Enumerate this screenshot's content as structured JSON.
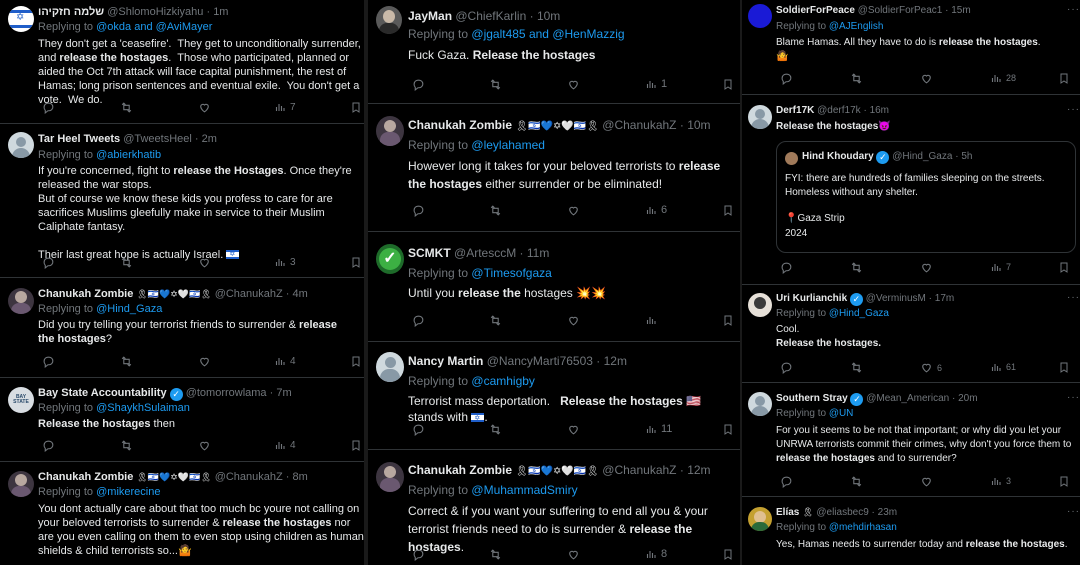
{
  "common": {
    "replying_to": "Replying to",
    "and": "and",
    "dot": "·",
    "more": "···"
  },
  "colors": {
    "background": "#000000",
    "text": "#e7e9ea",
    "muted": "#71767b",
    "link": "#1d9bf0",
    "divider": "#2f3336"
  },
  "icons": {
    "reply": "reply-icon",
    "repost": "repost-icon",
    "like": "like-icon",
    "views": "views-icon",
    "bookmark": "bookmark-icon"
  },
  "columns": [
    {
      "tweets": [
        {
          "name": "שלמה חזקיהו",
          "handle": "@ShlomoHizkiyahu",
          "time": "1m",
          "reply_to": [
            "@okda",
            "@AviMayer"
          ],
          "body_html": "They don't get a 'ceasefire'.  They get to unconditionally surrender, and <b>release the hostages</b>.  Those who participated, planned or aided the Oct 7th attack will face capital punishment, the rest of Hamas; long prison sentences and eventual exile.  You don't get a vote.  We do.",
          "views": "7"
        },
        {
          "name": "Tar Heel Tweets",
          "handle": "@TweetsHeel",
          "time": "2m",
          "reply_to": [
            "@abierkhatib"
          ],
          "body_html": "If you're concerned, fight to <b>release the Hostages</b>. Once they're released the war stops.\nBut of course we know these kids you profess to care for are sacrifices Muslims gleefully make in service to their Muslim Caliphate fantasy.\n\nTheir last great hope is actually Israel. [IL]",
          "views": "3"
        },
        {
          "name": "Chanukah Zombie",
          "name_emoji": "🎗🇮🇱💙✡🤍🇮🇱🎗",
          "handle": "@ChanukahZ",
          "time": "4m",
          "reply_to": [
            "@Hind_Gaza"
          ],
          "body_html": "Did you try telling your terrorist friends to surrender & <b>release the hostages</b>?",
          "views": "4"
        },
        {
          "name": "Bay State Accountability",
          "handle": "@tomorrowlama",
          "time": "7m",
          "reply_to": [
            "@ShaykhSulaiman"
          ],
          "body_html": "<b>Release the hostages</b> then",
          "views": "4"
        },
        {
          "name": "Chanukah Zombie",
          "name_emoji": "🎗🇮🇱💙✡🤍🇮🇱🎗",
          "handle": "@ChanukahZ",
          "time": "8m",
          "reply_to": [
            "@mikerecine"
          ],
          "body_html": "You dont actually care about that too much bc youre not calling on your beloved terrorists to surrender & <b>release the hostages</b> nor are you even calling on them to even stop using children as human shields & child terrorists so...🤷",
          "views": ""
        }
      ]
    },
    {
      "tweets": [
        {
          "name": "JayMan",
          "handle": "@ChiefKarlin",
          "time": "10m",
          "reply_to": [
            "@jgalt485",
            "@HenMazzig"
          ],
          "body_html": "Fuck Gaza. <b>Release the hostages</b>",
          "views": "1"
        },
        {
          "name": "Chanukah Zombie",
          "name_emoji": "🎗🇮🇱💙✡🤍🇮🇱🎗",
          "handle": "@ChanukahZ",
          "time": "10m",
          "reply_to": [
            "@leylahamed"
          ],
          "body_html": "However long it takes for your beloved terrorists to <b>release the hostages</b> either surrender or be eliminated!",
          "views": "6"
        },
        {
          "name": "SCMKT",
          "handle": "@ArtesccM",
          "time": "11m",
          "reply_to": [
            "@Timesofgaza"
          ],
          "body_html": "Until you <b>release the</b> hostages 💥💥",
          "views": ""
        },
        {
          "name": "Nancy Martin",
          "handle": "@NancyMarti76503",
          "time": "12m",
          "reply_to": [
            "@camhigby"
          ],
          "body_html": "Terrorist mass deportation.   <b>Release the hostages</b> 🇺🇸 stands with [IL].",
          "views": "11"
        },
        {
          "name": "Chanukah Zombie",
          "name_emoji": "🎗🇮🇱💙✡🤍🇮🇱🎗",
          "handle": "@ChanukahZ",
          "time": "12m",
          "reply_to": [
            "@MuhammadSmiry"
          ],
          "body_html": "Correct & if you want your suffering to end all you & your terrorist friends need to do is surrender & <b>release the hostages</b>.",
          "views": "8"
        }
      ]
    },
    {
      "tweets": [
        {
          "name": "SoldierForPeace",
          "handle": "@SoldierForPeac1",
          "time": "15m",
          "reply_to": [
            "@AJEnglish"
          ],
          "body_html": "Blame Hamas. All they have to do is <b>release the hostages</b>.\n🤷",
          "views": "28"
        },
        {
          "name": "Derf17K",
          "handle": "@derf17k",
          "time": "16m",
          "reply_to": [],
          "body_html": "<b>Release the hostages</b>😈",
          "views": "7",
          "quote": {
            "name": "Hind Khoudary",
            "handle": "@Hind_Gaza",
            "time": "5h",
            "body": "FYI: there are hundreds of families sleeping on the streets. Homeless without any shelter.",
            "location": "📍Gaza Strip",
            "year": "2024"
          }
        },
        {
          "name": "Uri Kurlianchik",
          "handle": "@VerminusM",
          "time": "17m",
          "reply_to": [
            "@Hind_Gaza"
          ],
          "body_html": "Cool.\n<b>Release the hostages.</b>",
          "likes": "6",
          "views": "61"
        },
        {
          "name": "Southern Stray",
          "handle": "@Mean_American",
          "time": "20m",
          "reply_to": [
            "@UN"
          ],
          "body_html": "For you it seems to be not that important; or why did you let your UNRWA terrorists commit their crimes, why don't you force them to <b>release the hostages</b> and to surrender?",
          "views": "3"
        },
        {
          "name": "Elías",
          "name_emoji": "🎗",
          "handle": "@eliasbec9",
          "time": "23m",
          "reply_to": [
            "@mehdirhasan"
          ],
          "body_html": "Yes, Hamas needs to surrender today and <b>release the hostages</b>.",
          "views": ""
        }
      ]
    }
  ]
}
